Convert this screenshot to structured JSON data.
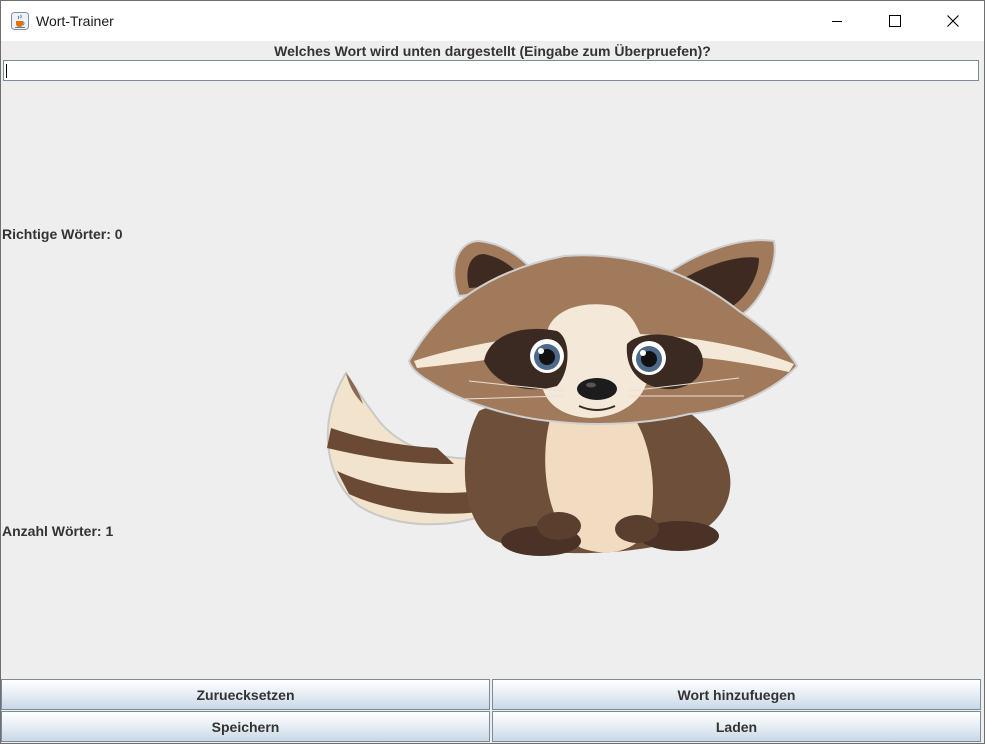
{
  "window": {
    "title": "Wort-Trainer"
  },
  "prompt": {
    "question": "Welches Wort wird unten dargestellt (Eingabe zum Überpruefen)?",
    "answer_value": ""
  },
  "stats": {
    "correct": "Richtige Wörter: 0",
    "total": "Anzahl Wörter: 1"
  },
  "image": {
    "subject": "raccoon"
  },
  "buttons": {
    "reset": "Zuruecksetzen",
    "add_word": "Wort hinzufuegen",
    "save": "Speichern",
    "load": "Laden"
  },
  "icons": {
    "app": "java-cup-icon",
    "minimize": "minimize-icon",
    "maximize": "maximize-icon",
    "close": "close-icon"
  },
  "colors": {
    "content_bg": "#eeeeee",
    "button_top": "#ffffff",
    "button_bottom": "#c9d8e6",
    "button_border": "#7a8a99"
  }
}
